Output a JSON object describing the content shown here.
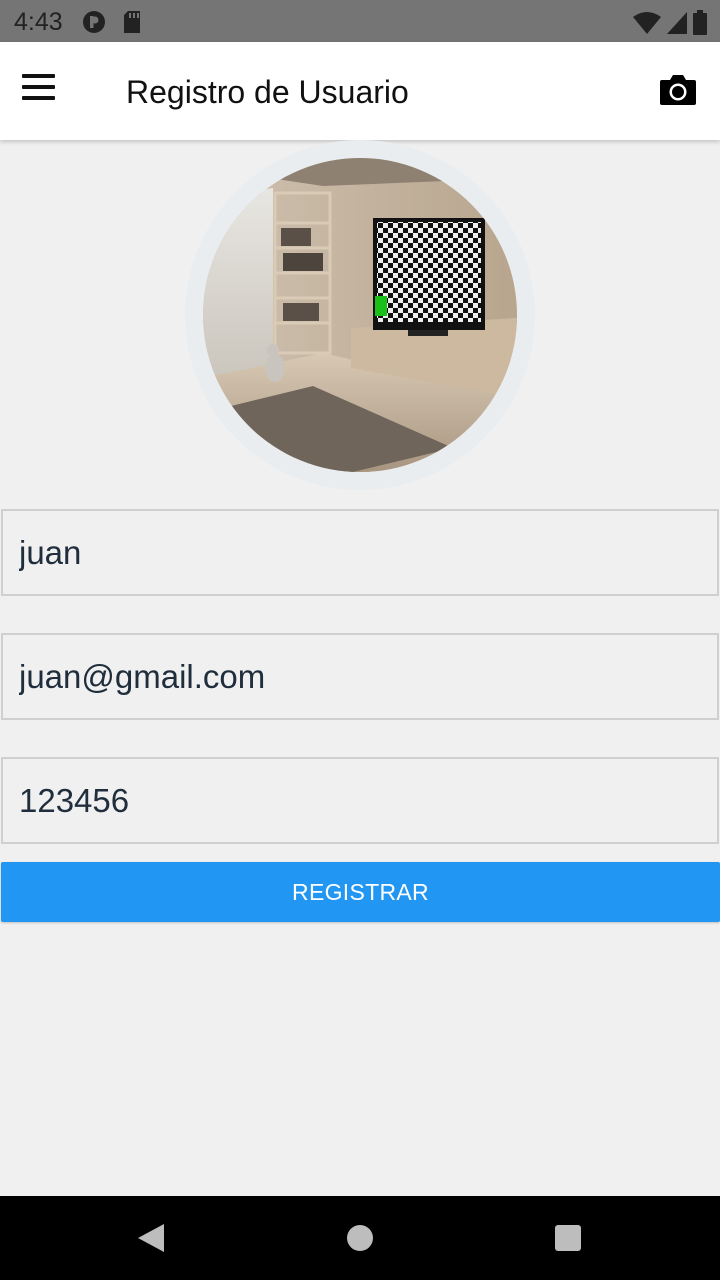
{
  "status_bar": {
    "time": "4:43"
  },
  "app_bar": {
    "title": "Registro de Usuario",
    "menu_icon": "hamburger-menu-icon",
    "camera_icon": "camera-icon"
  },
  "avatar": {
    "description_icon": "profile-photo"
  },
  "form": {
    "name_value": "juan",
    "email_value": "juan@gmail.com",
    "password_value": "123456",
    "submit_label": "REGISTRAR"
  },
  "colors": {
    "accent": "#2196f3",
    "status_bar": "#757575",
    "background": "#f0f0f0"
  }
}
